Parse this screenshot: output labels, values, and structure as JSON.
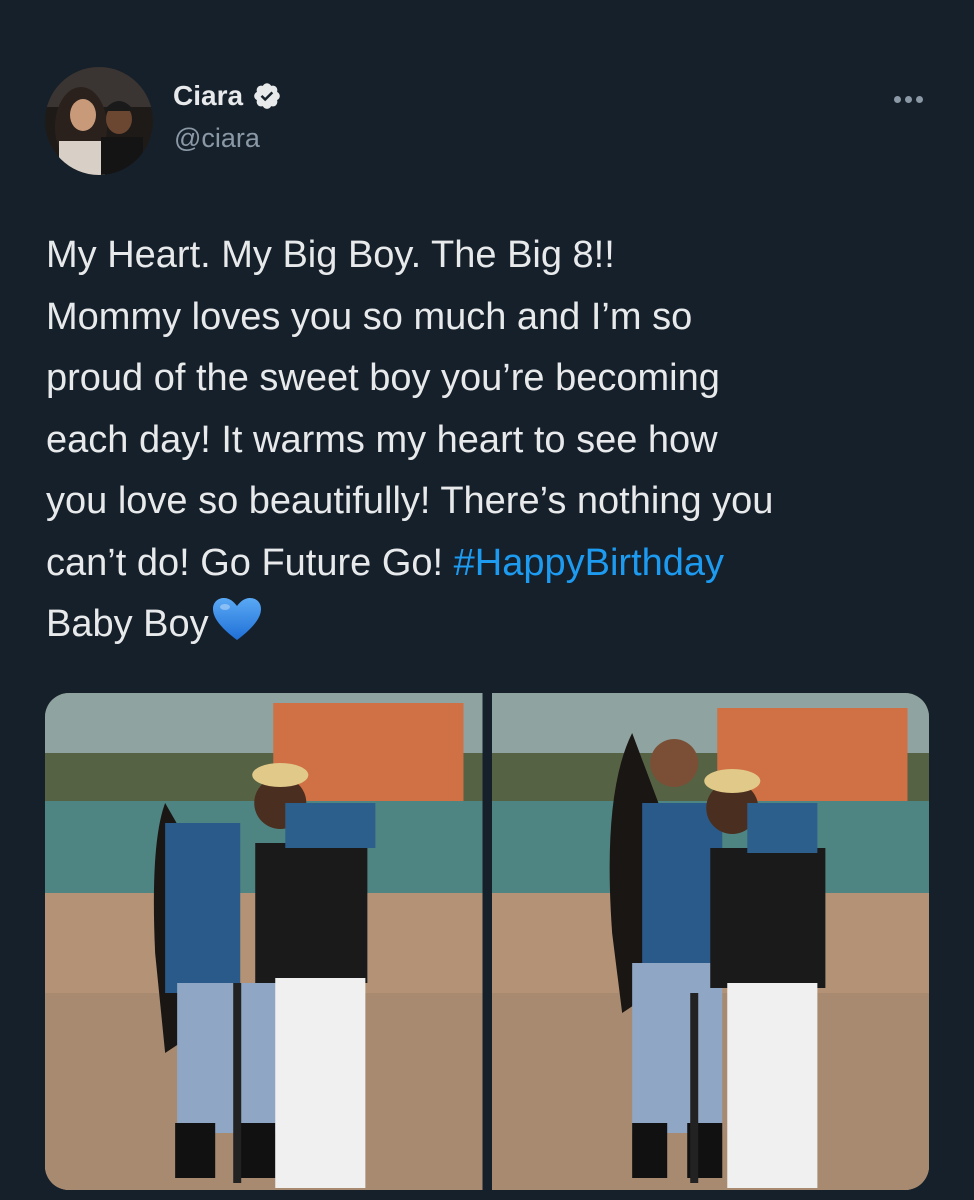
{
  "tweet": {
    "author": {
      "display_name": "Ciara",
      "handle": "@ciara",
      "verified": true,
      "avatar_icon": "profile-avatar"
    },
    "more_icon": "more-options-icon",
    "text_segments": [
      "My Heart. My Big Boy. The Big 8!!\nMommy loves you so much and I’m so\nproud of the sweet boy you’re becoming\neach day! It warms my heart to see how\nyou love so beautifully! There’s nothing you\ncan’t do! Go Future Go! ",
      "#HappyBirthday",
      "\nBaby Boy"
    ],
    "emoji": "blue-heart",
    "media": [
      {
        "kind": "photo"
      },
      {
        "kind": "photo"
      }
    ],
    "colors": {
      "background": "#15202b",
      "text": "#e7e9ea",
      "secondary": "#8b98a5",
      "link": "#1d9bf0"
    }
  }
}
